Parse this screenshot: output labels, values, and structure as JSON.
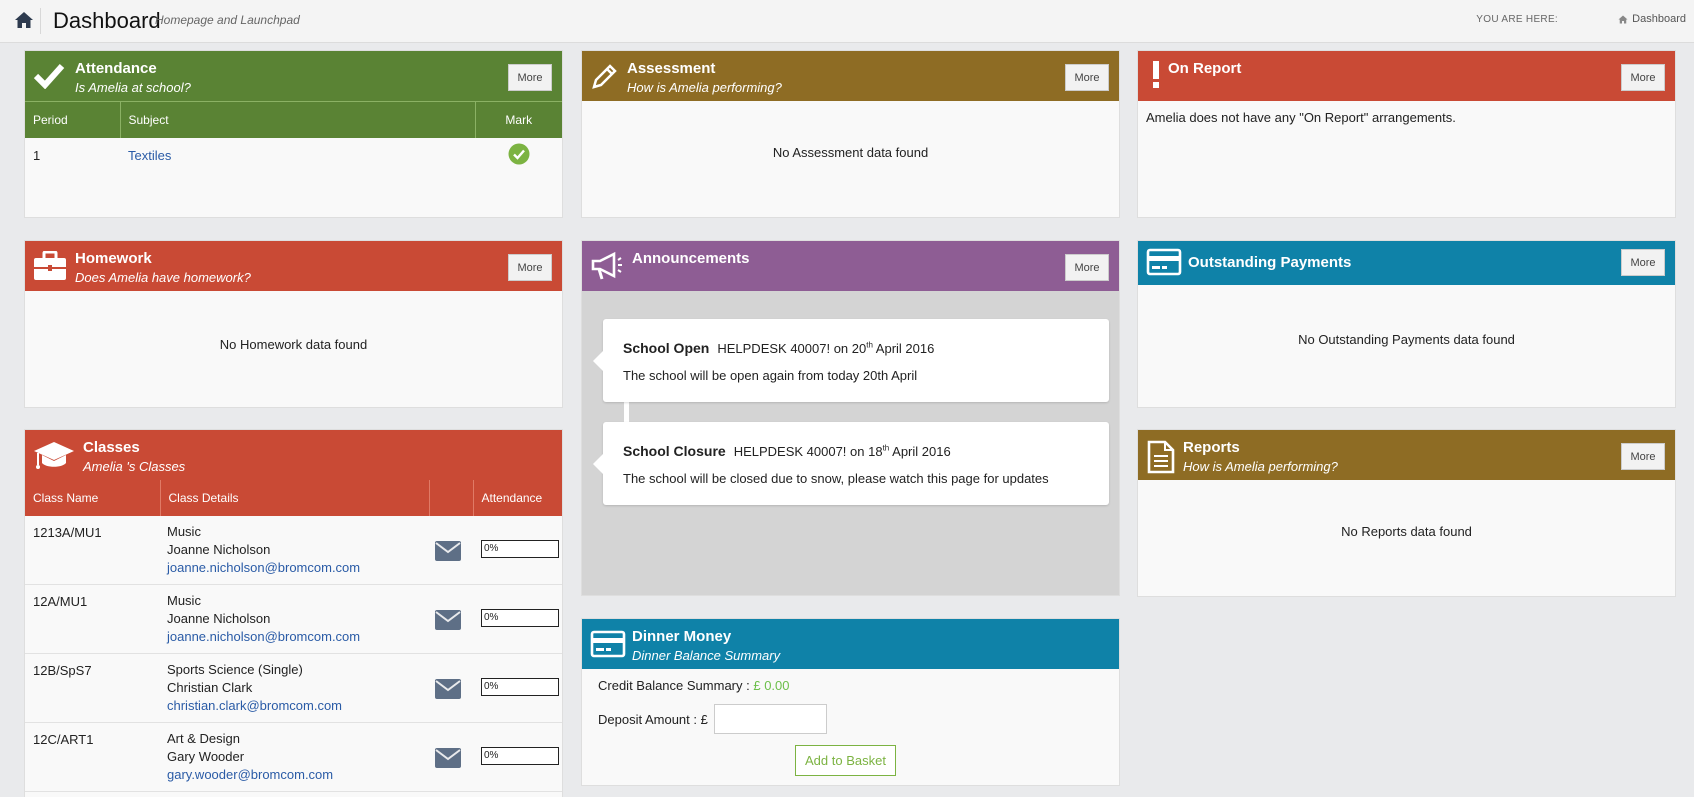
{
  "header": {
    "title": "Dashboard",
    "subtitle": "Homepage and Launchpad",
    "you_are_here": "YOU ARE HERE:",
    "breadcrumb": "Dashboard"
  },
  "more_label": "More",
  "attendance": {
    "title": "Attendance",
    "subtitle": "Is Amelia at school?",
    "columns": [
      "Period",
      "Subject",
      "Mark"
    ],
    "rows": [
      {
        "period": "1",
        "subject": "Textiles",
        "mark": "present"
      }
    ]
  },
  "assessment": {
    "title": "Assessment",
    "subtitle": "How is Amelia performing?",
    "empty": "No Assessment data found"
  },
  "on_report": {
    "title": "On Report",
    "message": "Amelia does not have any \"On Report\" arrangements."
  },
  "homework": {
    "title": "Homework",
    "subtitle": "Does Amelia have homework?",
    "empty": "No Homework data found"
  },
  "announcements": {
    "title": "Announcements",
    "items": [
      {
        "title": "School Open",
        "meta_prefix": "HELPDESK 40007! on 20",
        "meta_sup": "th",
        "meta_suffix": " April 2016",
        "body": "The school will be open again from today 20th April"
      },
      {
        "title": "School Closure",
        "meta_prefix": "HELPDESK 40007! on 18",
        "meta_sup": "th",
        "meta_suffix": " April 2016",
        "body": "The school will be closed due to snow, please watch this page for updates"
      }
    ]
  },
  "payments": {
    "title": "Outstanding Payments",
    "empty": "No Outstanding Payments data found"
  },
  "classes": {
    "title": "Classes",
    "subtitle": "Amelia 's Classes",
    "columns": [
      "Class Name",
      "Class Details",
      "",
      "Attendance"
    ],
    "rows": [
      {
        "class_name": "1213A/MU1",
        "subject": "Music",
        "teacher": "Joanne Nicholson",
        "email": "joanne.nicholson@bromcom.com",
        "attendance": "0%"
      },
      {
        "class_name": "12A/MU1",
        "subject": "Music",
        "teacher": "Joanne Nicholson",
        "email": "joanne.nicholson@bromcom.com",
        "attendance": "0%"
      },
      {
        "class_name": "12B/SpS7",
        "subject": "Sports Science (Single)",
        "teacher": "Christian Clark",
        "email": "christian.clark@bromcom.com",
        "attendance": "0%"
      },
      {
        "class_name": "12C/ART1",
        "subject": "Art & Design",
        "teacher": "Gary Wooder",
        "email": "gary.wooder@bromcom.com",
        "attendance": "0%"
      }
    ]
  },
  "reports": {
    "title": "Reports",
    "subtitle": "How is Amelia performing?",
    "empty": "No Reports data found"
  },
  "dinner_money": {
    "title": "Dinner Money",
    "subtitle": "Dinner Balance Summary",
    "credit_label": "Credit Balance Summary :",
    "credit_value": "£ 0.00",
    "deposit_label": "Deposit Amount : £",
    "deposit_value": "",
    "add_button": "Add to Basket"
  },
  "colors": {
    "attendance": "#5a8334",
    "homework": "#c94a35",
    "classes": "#c94a35",
    "on_report": "#c94a35",
    "assessment": "#8e6c24",
    "reports": "#8e6c24",
    "announcements": "#8e5d94",
    "payments": "#0f82a8",
    "dinner_money": "#0f82a8",
    "link": "#2a5ba6",
    "credit": "#6cbf4a"
  }
}
